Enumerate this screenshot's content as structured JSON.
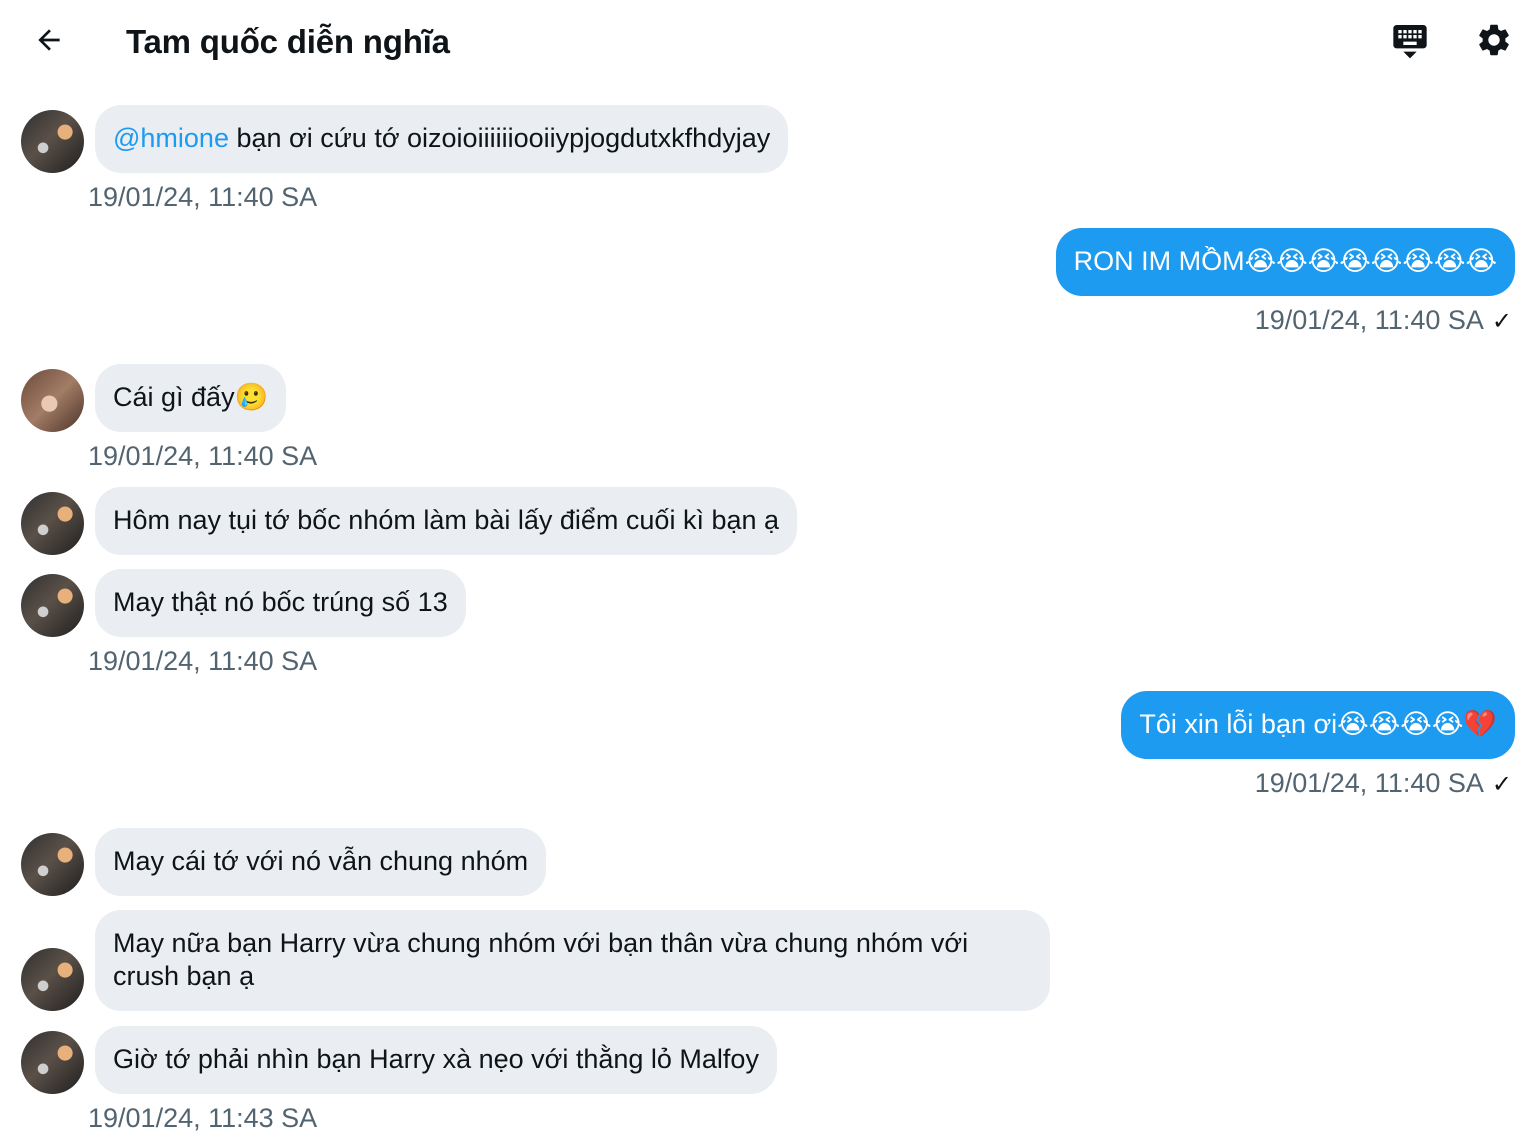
{
  "header": {
    "title": "Tam quốc diễn nghĩa"
  },
  "messages": [
    {
      "dir": "in",
      "mention": "@hmione",
      "text": " bạn ơi cứu tớ oizoioiiiiiiooiiypjogdutxkfhdyjay",
      "timestamp": "19/01/24, 11:40 SA"
    },
    {
      "dir": "out",
      "text": "RON IM MỒM😭😭😭😭😭😭😭😭",
      "timestamp": "19/01/24, 11:40 SA",
      "check": "✓"
    },
    {
      "dir": "in",
      "text": "Cái gì đấy🥲",
      "timestamp": "19/01/24, 11:40 SA"
    },
    {
      "dir": "in",
      "text": "Hôm nay tụi tớ bốc nhóm làm bài lấy điểm cuối kì bạn ạ"
    },
    {
      "dir": "in",
      "text": "May thật nó bốc trúng số 13",
      "timestamp": "19/01/24, 11:40 SA"
    },
    {
      "dir": "out",
      "text": "Tôi xin lỗi bạn ơi😭😭😭😭💔",
      "timestamp": "19/01/24, 11:40 SA",
      "check": "✓"
    },
    {
      "dir": "in",
      "text": "May cái tớ với nó vẫn chung nhóm"
    },
    {
      "dir": "in",
      "text": "May nữa bạn Harry vừa chung nhóm với bạn thân vừa chung nhóm với crush bạn ạ"
    },
    {
      "dir": "in",
      "text": "Giờ tớ phải nhìn bạn Harry xà nẹo với thằng lỏ Malfoy",
      "timestamp": "19/01/24, 11:43 SA"
    }
  ],
  "icons": {
    "back": "arrow-left-icon",
    "keyboard": "keyboard-icon",
    "settings": "gear-icon"
  },
  "colors": {
    "accent": "#1d9bf0",
    "incoming_bubble": "#eaeef2",
    "timestamp": "#536471"
  }
}
